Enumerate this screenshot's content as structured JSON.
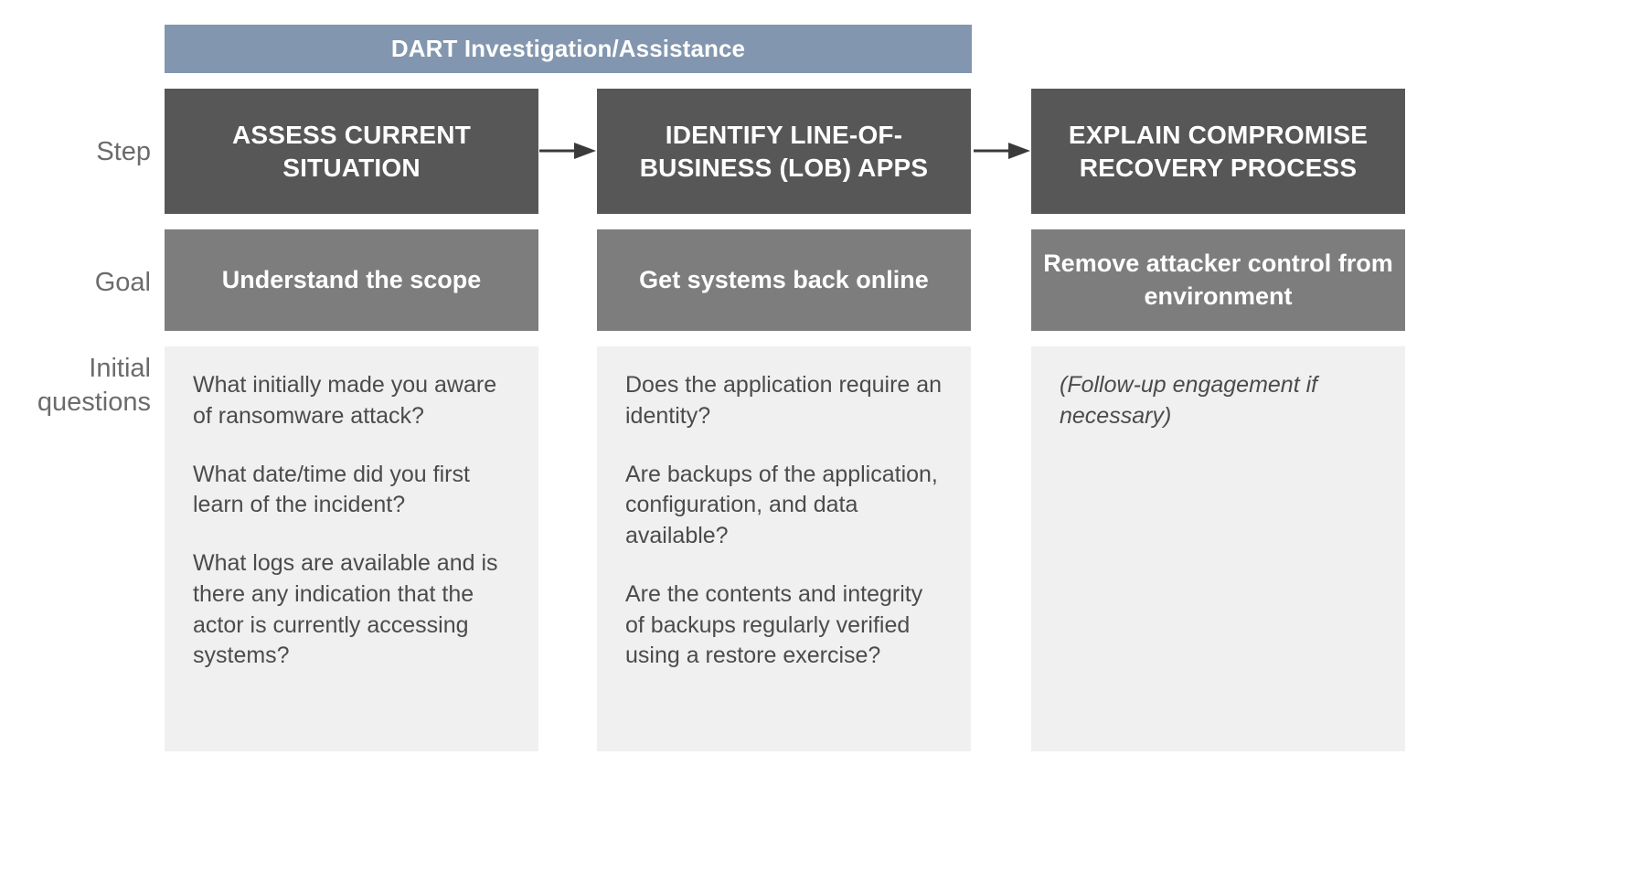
{
  "banner": {
    "title": "DART Investigation/Assistance"
  },
  "row_labels": {
    "step": "Step",
    "goal": "Goal",
    "questions": "Initial questions"
  },
  "colors": {
    "banner": "#8296af",
    "step_box": "#575757",
    "goal_box": "#7d7d7d",
    "question_panel": "#f0f0f0",
    "label_text": "#6b6b6b",
    "body_text": "#4b4b4b",
    "arrow": "#3a3a3a"
  },
  "columns": [
    {
      "step": "ASSESS CURRENT SITUATION",
      "goal": "Understand the scope",
      "questions": [
        "What initially made you aware of ransomware attack?",
        "What date/time did you first learn of the incident?",
        "What logs are available and is there any indication that the actor is currently accessing systems?"
      ],
      "questions_italic": false
    },
    {
      "step": "IDENTIFY LINE-OF-BUSINESS (LOB) APPS",
      "goal": "Get systems back online",
      "questions": [
        "Does the application require an identity?",
        "Are backups of the application, configuration, and data available?",
        "Are the contents and integrity of backups regularly verified using a restore exercise?"
      ],
      "questions_italic": false
    },
    {
      "step": "EXPLAIN COMPROMISE RECOVERY PROCESS",
      "goal": "Remove attacker control from environment",
      "questions": [
        "(Follow-up engagement if necessary)"
      ],
      "questions_italic": true
    }
  ],
  "arrows": [
    {
      "name": "arrow-step-1-to-2",
      "direction": "right"
    },
    {
      "name": "arrow-step-2-to-3",
      "direction": "right"
    }
  ]
}
